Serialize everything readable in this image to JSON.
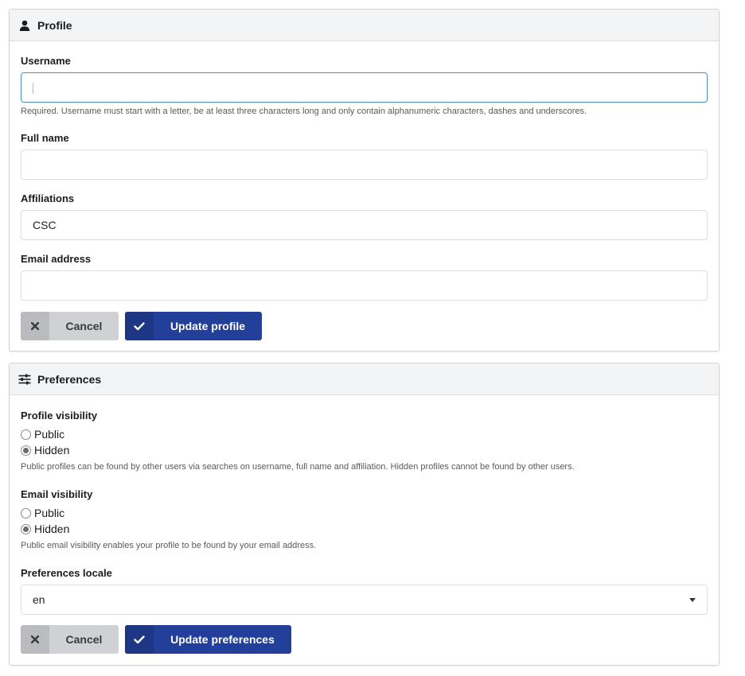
{
  "profile": {
    "header": "Profile",
    "header_icon": "user-icon",
    "username": {
      "label": "Username",
      "value": "",
      "help": "Required. Username must start with a letter, be at least three characters long and only contain alphanumeric characters, dashes and underscores."
    },
    "full_name": {
      "label": "Full name",
      "value": ""
    },
    "affiliations": {
      "label": "Affiliations",
      "value": "CSC"
    },
    "email": {
      "label": "Email address",
      "value": ""
    },
    "cancel_label": "Cancel",
    "submit_label": "Update profile"
  },
  "preferences": {
    "header": "Preferences",
    "header_icon": "sliders-icon",
    "profile_visibility": {
      "label": "Profile visibility",
      "options": [
        "Public",
        "Hidden"
      ],
      "selected": "Hidden",
      "help": "Public profiles can be found by other users via searches on username, full name and affiliation. Hidden profiles cannot be found by other users."
    },
    "email_visibility": {
      "label": "Email visibility",
      "options": [
        "Public",
        "Hidden"
      ],
      "selected": "Hidden",
      "help": "Public email visibility enables your profile to be found by your email address."
    },
    "locale": {
      "label": "Preferences locale",
      "value": "en"
    },
    "cancel_label": "Cancel",
    "submit_label": "Update preferences"
  },
  "colors": {
    "primary": "#22409a",
    "cancel": "#cfd1d4",
    "focus_border": "#4a8fc0"
  }
}
